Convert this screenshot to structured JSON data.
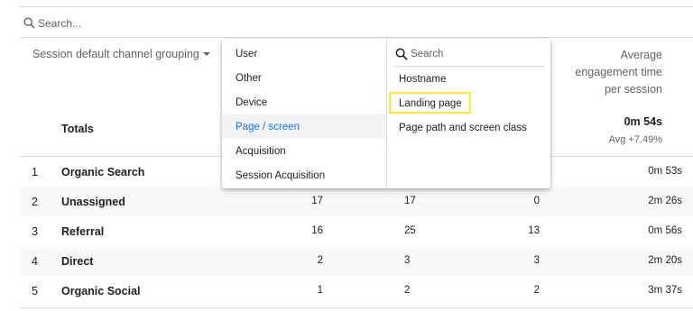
{
  "search": {
    "placeholder": "Search..."
  },
  "header": {
    "dimension_label": "Session default channel grouping",
    "metric_title_lines": [
      "Average",
      "engagement time",
      "per session"
    ]
  },
  "totals": {
    "label": "Totals",
    "value": "0m 54s",
    "delta": "Avg +7.49%"
  },
  "rows": [
    {
      "index": "1",
      "name": "Organic Search",
      "col1": "",
      "col2": "",
      "col3": "",
      "col4": "0m 53s"
    },
    {
      "index": "2",
      "name": "Unassigned",
      "col1": "17",
      "col2": "17",
      "col3": "0",
      "col4": "2m 26s"
    },
    {
      "index": "3",
      "name": "Referral",
      "col1": "16",
      "col2": "25",
      "col3": "13",
      "col4": "0m 56s"
    },
    {
      "index": "4",
      "name": "Direct",
      "col1": "2",
      "col2": "3",
      "col3": "3",
      "col4": "2m 20s"
    },
    {
      "index": "5",
      "name": "Organic Social",
      "col1": "1",
      "col2": "2",
      "col3": "2",
      "col4": "3m 37s"
    }
  ],
  "menu": {
    "categories": [
      {
        "label": "User"
      },
      {
        "label": "Other"
      },
      {
        "label": "Device"
      },
      {
        "label": "Page / screen",
        "active": true
      },
      {
        "label": "Acquisition"
      },
      {
        "label": "Session Acquisition"
      }
    ],
    "search_placeholder": "Search",
    "options": [
      {
        "label": "Hostname"
      },
      {
        "label": "Landing page",
        "highlighted": true
      },
      {
        "label": "Page path and screen class"
      }
    ]
  },
  "colors": {
    "accent": "#1a73e8",
    "highlight": "#fde92a",
    "divider": "#dadce0"
  },
  "icons": {
    "search": "search-icon",
    "dropdown": "chevron-down-icon"
  }
}
